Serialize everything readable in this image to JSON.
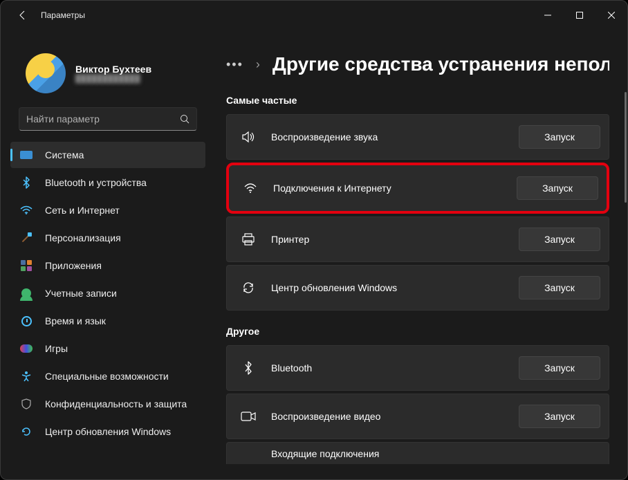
{
  "window": {
    "title": "Параметры"
  },
  "profile": {
    "name": "Виктор Бухтеев",
    "subtitle": "████████████"
  },
  "search": {
    "placeholder": "Найти параметр"
  },
  "nav": {
    "items": [
      {
        "id": "system",
        "label": "Система"
      },
      {
        "id": "bluetooth",
        "label": "Bluetooth и устройства"
      },
      {
        "id": "network",
        "label": "Сеть и Интернет"
      },
      {
        "id": "personalization",
        "label": "Персонализация"
      },
      {
        "id": "apps",
        "label": "Приложения"
      },
      {
        "id": "accounts",
        "label": "Учетные записи"
      },
      {
        "id": "time",
        "label": "Время и язык"
      },
      {
        "id": "games",
        "label": "Игры"
      },
      {
        "id": "accessibility",
        "label": "Специальные возможности"
      },
      {
        "id": "privacy",
        "label": "Конфиденциальность и защита"
      },
      {
        "id": "update",
        "label": "Центр обновления Windows"
      }
    ]
  },
  "breadcrumb": {
    "title": "Другие средства устранения непола"
  },
  "sections": {
    "frequent": "Самые частые",
    "other": "Другое"
  },
  "run_label": "Запуск",
  "troubleshooters": {
    "frequent": [
      {
        "id": "audio",
        "label": "Воспроизведение звука"
      },
      {
        "id": "internet",
        "label": "Подключения к Интернету",
        "highlight": true
      },
      {
        "id": "printer",
        "label": "Принтер"
      },
      {
        "id": "windows-update",
        "label": "Центр обновления Windows"
      }
    ],
    "other": [
      {
        "id": "bluetooth-t",
        "label": "Bluetooth"
      },
      {
        "id": "video",
        "label": "Воспроизведение видео"
      },
      {
        "id": "incoming",
        "label": "Входящие подключения"
      }
    ]
  }
}
